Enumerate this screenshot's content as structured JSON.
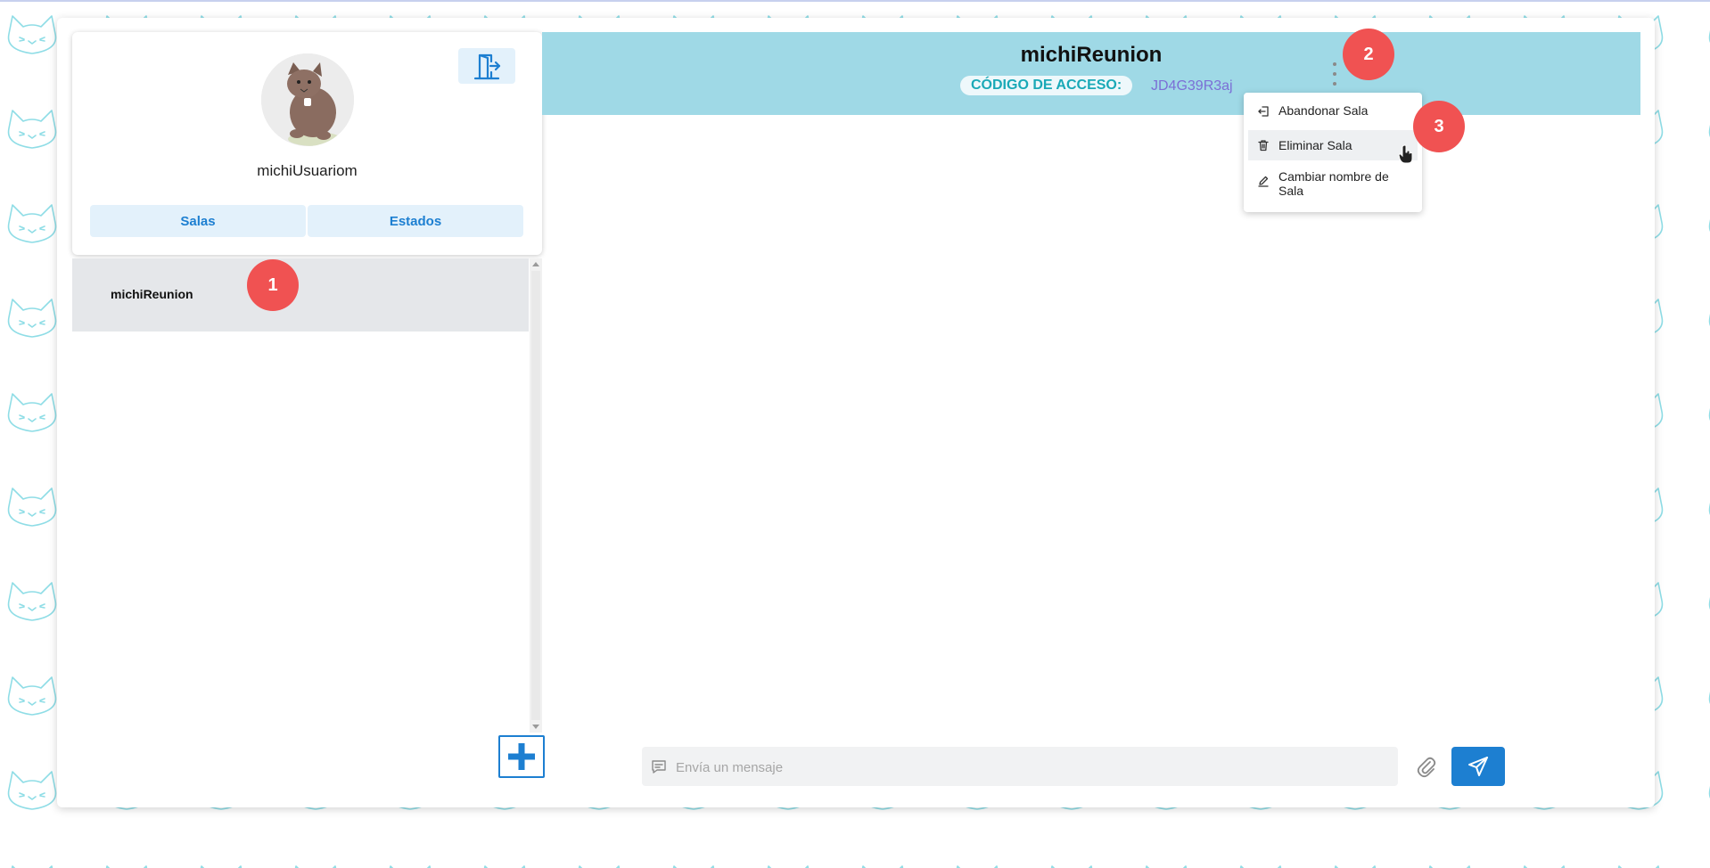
{
  "profile": {
    "username": "michiUsuariom",
    "tabs": [
      "Salas",
      "Estados"
    ]
  },
  "rooms": [
    {
      "name": "michiReunion"
    }
  ],
  "chat": {
    "room_title": "michiReunion",
    "access_code_label": "CÓDIGO DE ACCESO:",
    "access_code": "JD4G39R3aj",
    "message_placeholder": "Envía un mensaje"
  },
  "room_menu": {
    "items": [
      {
        "label": "Abandonar Sala",
        "icon": "leave-icon"
      },
      {
        "label": "Eliminar Sala",
        "icon": "trash-icon"
      },
      {
        "label": "Cambiar nombre de Sala",
        "icon": "edit-icon"
      }
    ]
  },
  "markers": [
    "1",
    "2",
    "3"
  ],
  "colors": {
    "accent": "#1d7fd1",
    "header_bg": "#9fd9e6",
    "marker": "#f05252",
    "code_label": "#1aa9b7",
    "code_value": "#7b6fd6"
  }
}
